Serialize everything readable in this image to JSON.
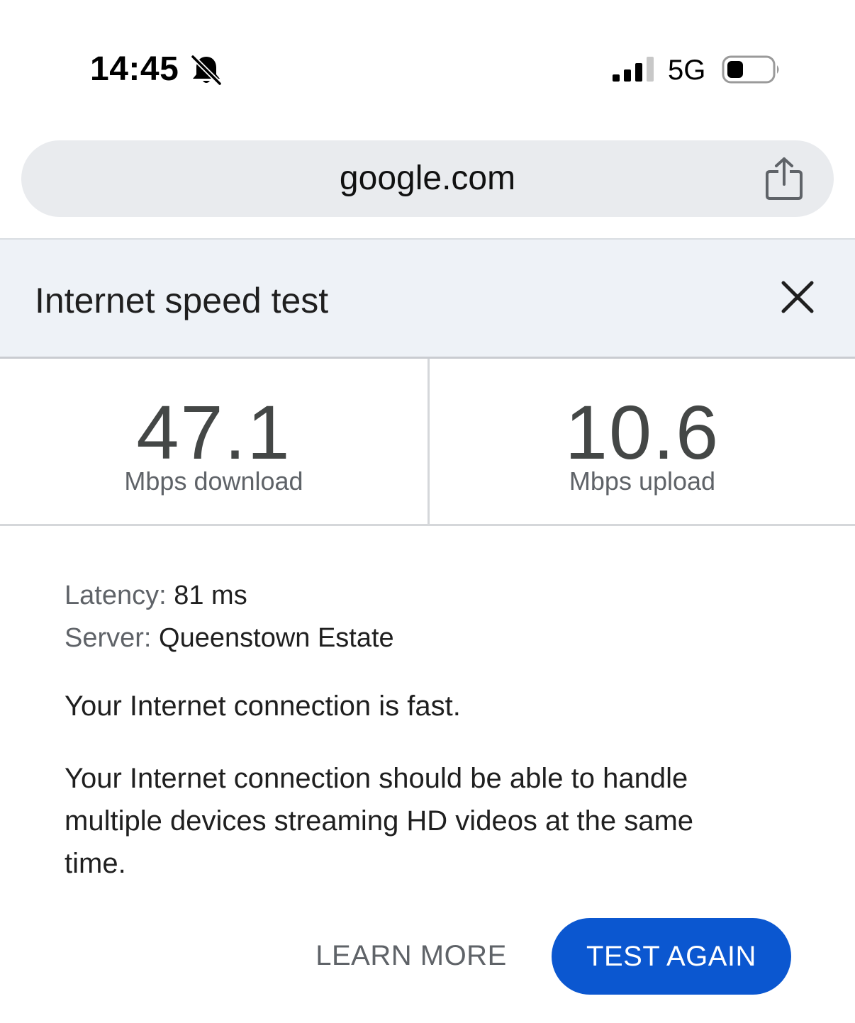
{
  "status_bar": {
    "time": "14:45",
    "silent_icon": "bell-slash-icon",
    "signal_icon": "cellular-signal-icon",
    "network": "5G",
    "battery_icon": "battery-icon"
  },
  "browser": {
    "url": "google.com",
    "share_icon": "share-icon"
  },
  "card": {
    "title": "Internet speed test",
    "close_icon": "close-icon",
    "download": {
      "value": "47.1",
      "label": "Mbps download"
    },
    "upload": {
      "value": "10.6",
      "label": "Mbps upload"
    },
    "latency": {
      "label": "Latency:",
      "value": "81 ms"
    },
    "server": {
      "label": "Server:",
      "value": "Queenstown Estate"
    },
    "assessment": "Your Internet connection is fast.",
    "description": "Your Internet connection should be able to handle multiple devices streaming HD videos at the same time.",
    "buttons": {
      "learn_more": "LEARN MORE",
      "test_again": "TEST AGAIN"
    }
  },
  "colors": {
    "accent": "#0b57d0",
    "header_background": "#eef2f7",
    "url_bar_background": "#e9ebee"
  }
}
